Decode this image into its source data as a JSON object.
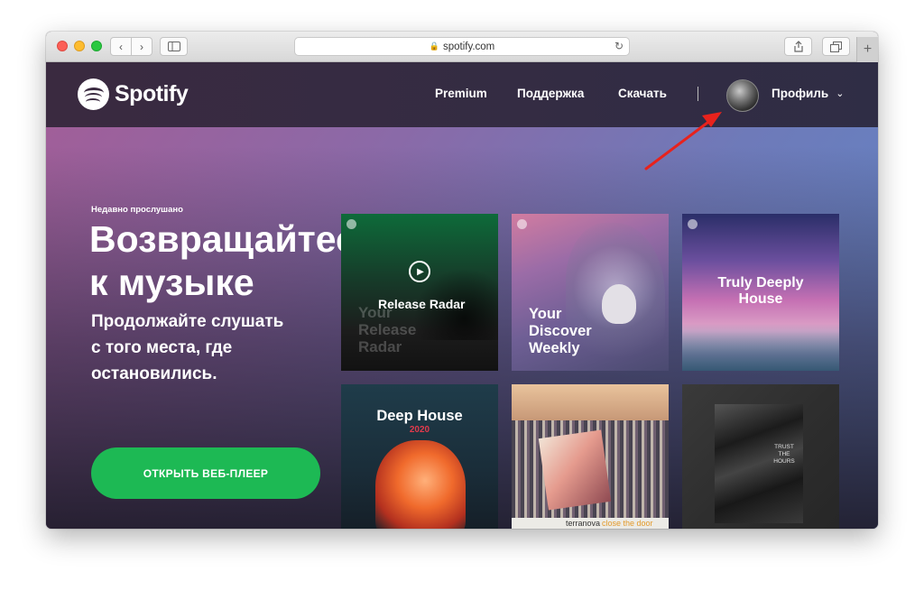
{
  "browser": {
    "url": "spotify.com",
    "nav_back": "‹",
    "nav_forward": "›",
    "reload_icon": "↻",
    "lock_icon": "🔒",
    "new_tab": "+"
  },
  "navbar": {
    "logo_text": "Spotify",
    "links": [
      "Premium",
      "Поддержка",
      "Скачать"
    ],
    "profile_label": "Профиль",
    "chevron": "⌄"
  },
  "hero": {
    "kicker": "Недавно прослушано",
    "title_line1": "Возвращайтесь",
    "title_line2": "к музыке",
    "subtitle_line1": "Продолжайте слушать",
    "subtitle_line2": "с того места, где",
    "subtitle_line3": "остановились.",
    "cta_label": "ОТКРЫТЬ ВЕБ-ПЛЕЕР"
  },
  "tiles": {
    "release_radar": {
      "title": "Release Radar",
      "ghost_line1": "Your",
      "ghost_line2": "Release",
      "ghost_line3": "Radar",
      "play_icon": "▶"
    },
    "discover_weekly": {
      "line1": "Your",
      "line2": "Discover",
      "line3": "Weekly"
    },
    "truly_deeply": {
      "line1": "Truly Deeply",
      "line2": "House"
    },
    "deep_house": {
      "title": "Deep House",
      "year": "2020"
    },
    "terranova": {
      "artist": "terranova",
      "album": "close the door"
    },
    "trust_hours": {
      "line1": "TRUST",
      "line2": "THE",
      "line3": "HOURS"
    }
  },
  "colors": {
    "accent_green": "#1db954",
    "annotation_arrow": "#e8221c",
    "navbar_bg": "#3a2a40"
  },
  "icons": [
    "traffic-lights",
    "sidebar-icon",
    "share-icon",
    "tabs-icon",
    "lock-icon",
    "reload-icon",
    "play-icon",
    "chevron-down-icon",
    "annotation-arrow"
  ]
}
